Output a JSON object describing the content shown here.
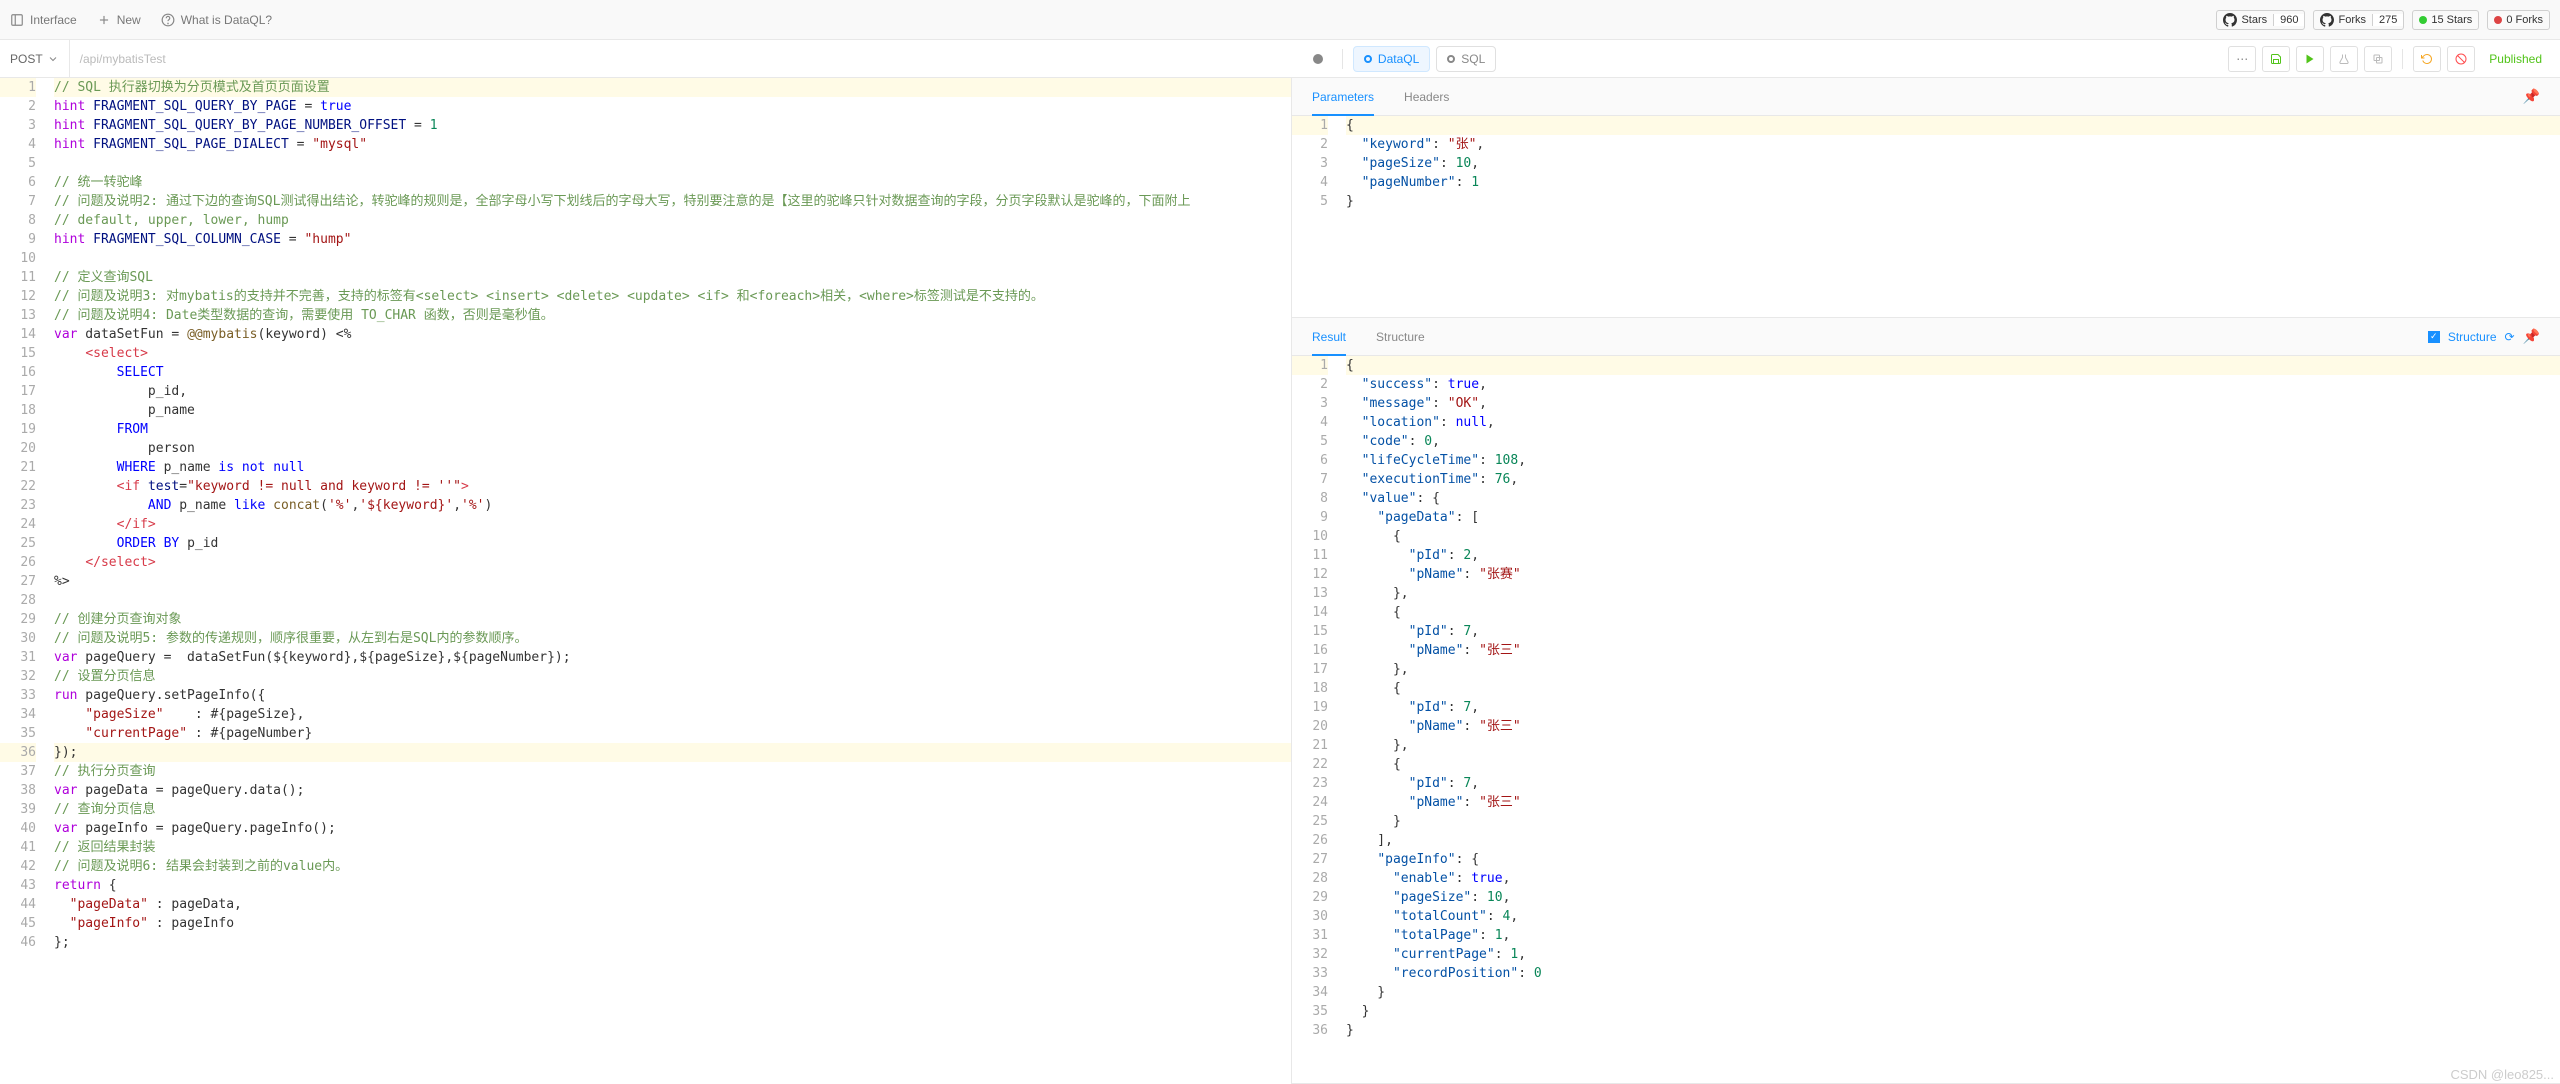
{
  "topbar": {
    "interface": "Interface",
    "new": "New",
    "what_is": "What is DataQL?",
    "badges": [
      {
        "left": "Stars",
        "right": "960",
        "icon": "github"
      },
      {
        "left": "Forks",
        "right": "275",
        "icon": "github"
      },
      {
        "left": "15 Stars",
        "right": "",
        "icon": "green"
      },
      {
        "left": "0 Forks",
        "right": "",
        "icon": "red"
      }
    ]
  },
  "request": {
    "method": "POST",
    "url": "/api/mybatisTest",
    "tabs": {
      "dataql": "DataQL",
      "sql": "SQL"
    },
    "published": "Published"
  },
  "right_top": {
    "tabs": {
      "parameters": "Parameters",
      "headers": "Headers"
    }
  },
  "right_bottom": {
    "tabs": {
      "result": "Result",
      "structure": "Structure"
    },
    "structure_label": "Structure"
  },
  "params_json_lines": [
    "{",
    "  \"keyword\": \"张\",",
    "  \"pageSize\": 10,",
    "  \"pageNumber\": 1",
    "}"
  ],
  "result_json_lines": [
    "{",
    "  \"success\": true,",
    "  \"message\": \"OK\",",
    "  \"location\": null,",
    "  \"code\": 0,",
    "  \"lifeCycleTime\": 108,",
    "  \"executionTime\": 76,",
    "  \"value\": {",
    "    \"pageData\": [",
    "      {",
    "        \"pId\": 2,",
    "        \"pName\": \"张赛\"",
    "      },",
    "      {",
    "        \"pId\": 7,",
    "        \"pName\": \"张三\"",
    "      },",
    "      {",
    "        \"pId\": 7,",
    "        \"pName\": \"张三\"",
    "      },",
    "      {",
    "        \"pId\": 7,",
    "        \"pName\": \"张三\"",
    "      }",
    "    ],",
    "    \"pageInfo\": {",
    "      \"enable\": true,",
    "      \"pageSize\": 10,",
    "      \"totalCount\": 4,",
    "      \"totalPage\": 1,",
    "      \"currentPage\": 1,",
    "      \"recordPosition\": 0",
    "    }",
    "  }",
    "}"
  ],
  "code_lines": [
    {
      "t": "// SQL 执行器切换为分页模式及首页页面设置",
      "cls": "c-comment-g",
      "hl": true
    },
    {
      "raw": "<span class='c-kw2'>hint</span> <span class='c-prop'>FRAGMENT_SQL_QUERY_BY_PAGE</span> = <span class='c-bool'>true</span>"
    },
    {
      "raw": "<span class='c-kw2'>hint</span> <span class='c-prop'>FRAGMENT_SQL_QUERY_BY_PAGE_NUMBER_OFFSET</span> = <span class='c-num'>1</span>"
    },
    {
      "raw": "<span class='c-kw2'>hint</span> <span class='c-prop'>FRAGMENT_SQL_PAGE_DIALECT</span> = <span class='c-str'>\"mysql\"</span>"
    },
    {
      "t": ""
    },
    {
      "t": "// 统一转驼峰",
      "cls": "c-comment-g"
    },
    {
      "t": "// 问题及说明2: 通过下边的查询SQL测试得出结论，转驼峰的规则是，全部字母小写下划线后的字母大写，特别要注意的是【这里的驼峰只针对数据查询的字段，分页字段默认是驼峰的，下面附上",
      "cls": "c-comment-g"
    },
    {
      "t": "// default, upper, lower, hump",
      "cls": "c-comment-g"
    },
    {
      "raw": "<span class='c-kw2'>hint</span> <span class='c-prop'>FRAGMENT_SQL_COLUMN_CASE</span> = <span class='c-str'>\"hump\"</span>"
    },
    {
      "t": ""
    },
    {
      "t": "// 定义查询SQL",
      "cls": "c-comment-g"
    },
    {
      "t": "// 问题及说明3: 对mybatis的支持并不完善，支持的标签有<select> <insert> <delete> <update> <if> 和<foreach>相关，<where>标签测试是不支持的。",
      "cls": "c-comment-g"
    },
    {
      "t": "// 问题及说明4: Date类型数据的查询，需要使用 TO_CHAR 函数，否则是毫秒值。",
      "cls": "c-comment-g"
    },
    {
      "raw": "<span class='c-kw2'>var</span> dataSetFun = <span class='c-fn'>@@mybatis</span>(keyword) &lt;%"
    },
    {
      "raw": "    <span class='c-red'>&lt;select&gt;</span>"
    },
    {
      "raw": "        <span class='c-kw'>SELECT</span>"
    },
    {
      "t": "            p_id,"
    },
    {
      "t": "            p_name"
    },
    {
      "raw": "        <span class='c-kw'>FROM</span>"
    },
    {
      "t": "            person"
    },
    {
      "raw": "        <span class='c-kw'>WHERE</span> p_name <span class='c-kw'>is not</span> <span class='c-bool'>null</span>"
    },
    {
      "raw": "        <span class='c-red'>&lt;if</span> <span class='c-prop'>test</span>=<span class='c-str'>\"keyword != null and keyword != ''\"</span><span class='c-red'>&gt;</span>"
    },
    {
      "raw": "            <span class='c-kw'>AND</span> p_name <span class='c-kw'>like</span> <span class='c-fn'>concat</span>(<span class='c-str'>'%'</span>,<span class='c-str'>'${keyword}'</span>,<span class='c-str'>'%'</span>)"
    },
    {
      "raw": "        <span class='c-red'>&lt;/if&gt;</span>"
    },
    {
      "raw": "        <span class='c-kw'>ORDER BY</span> p_id"
    },
    {
      "raw": "    <span class='c-red'>&lt;/select&gt;</span>"
    },
    {
      "t": "%>"
    },
    {
      "t": ""
    },
    {
      "t": "// 创建分页查询对象",
      "cls": "c-comment-g"
    },
    {
      "t": "// 问题及说明5: 参数的传递规则，顺序很重要，从左到右是SQL内的参数顺序。",
      "cls": "c-comment-g"
    },
    {
      "raw": "<span class='c-kw2'>var</span> pageQuery =  dataSetFun(${keyword},${pageSize},${pageNumber});"
    },
    {
      "t": "// 设置分页信息",
      "cls": "c-comment-g"
    },
    {
      "raw": "<span class='c-kw2'>run</span> pageQuery.setPageInfo({"
    },
    {
      "raw": "    <span class='c-str'>\"pageSize\"</span>    : #{pageSize},"
    },
    {
      "raw": "    <span class='c-str'>\"currentPage\"</span> : #{pageNumber}"
    },
    {
      "t": "});",
      "hl": true
    },
    {
      "t": "// 执行分页查询",
      "cls": "c-comment-g"
    },
    {
      "raw": "<span class='c-kw2'>var</span> pageData = pageQuery.data();"
    },
    {
      "t": "// 查询分页信息",
      "cls": "c-comment-g"
    },
    {
      "raw": "<span class='c-kw2'>var</span> pageInfo = pageQuery.pageInfo();"
    },
    {
      "t": "// 返回结果封装",
      "cls": "c-comment-g"
    },
    {
      "t": "// 问题及说明6: 结果会封装到之前的value内。",
      "cls": "c-comment-g"
    },
    {
      "raw": "<span class='c-kw2'>return</span> {"
    },
    {
      "raw": "  <span class='c-str'>\"pageData\"</span> : pageData,"
    },
    {
      "raw": "  <span class='c-str'>\"pageInfo\"</span> : pageInfo"
    },
    {
      "t": "};"
    }
  ],
  "watermark": "CSDN @leo825..."
}
